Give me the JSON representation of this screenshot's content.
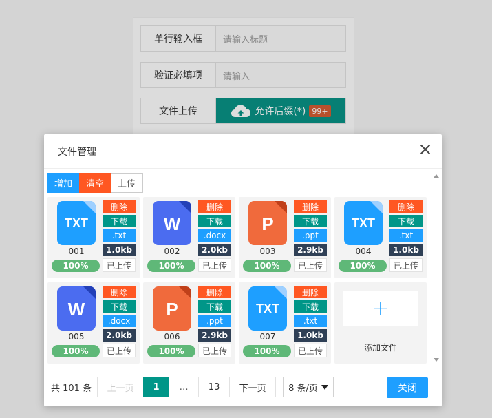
{
  "form": {
    "row1_label": "单行输入框",
    "row1_placeholder": "请输入标题",
    "row2_label": "验证必填项",
    "row2_placeholder": "请输入",
    "row3_label": "文件上传",
    "upload_label": "允许后缀(*)",
    "upload_badge": "99+"
  },
  "modal": {
    "title": "文件管理",
    "toolbar": {
      "add": "增加",
      "clear": "清空",
      "upload": "上传"
    },
    "files": [
      {
        "name": "001",
        "type": "txt",
        "glyph": "TXT",
        "ext": ".txt",
        "size": "1.0kb",
        "progress": "100%",
        "status": "已上传",
        "delete": "删除",
        "download": "下载",
        "color": "#1e9fff",
        "fold": "#9fd0ff"
      },
      {
        "name": "002",
        "type": "docx",
        "glyph": "W",
        "ext": ".docx",
        "size": "2.0kb",
        "progress": "100%",
        "status": "已上传",
        "delete": "删除",
        "download": "下载",
        "color": "#4b6cf0",
        "fold": "#2340b8"
      },
      {
        "name": "003",
        "type": "ppt",
        "glyph": "P",
        "ext": ".ppt",
        "size": "2.9kb",
        "progress": "100%",
        "status": "已上传",
        "delete": "删除",
        "download": "下载",
        "color": "#f06a3c",
        "fold": "#c0401a"
      },
      {
        "name": "004",
        "type": "txt",
        "glyph": "TXT",
        "ext": ".txt",
        "size": "1.0kb",
        "progress": "100%",
        "status": "已上传",
        "delete": "删除",
        "download": "下载",
        "color": "#1e9fff",
        "fold": "#9fd0ff"
      },
      {
        "name": "005",
        "type": "docx",
        "glyph": "W",
        "ext": ".docx",
        "size": "2.0kb",
        "progress": "100%",
        "status": "已上传",
        "delete": "删除",
        "download": "下载",
        "color": "#4b6cf0",
        "fold": "#2340b8"
      },
      {
        "name": "006",
        "type": "ppt",
        "glyph": "P",
        "ext": ".ppt",
        "size": "2.9kb",
        "progress": "100%",
        "status": "已上传",
        "delete": "删除",
        "download": "下载",
        "color": "#f06a3c",
        "fold": "#c0401a"
      },
      {
        "name": "007",
        "type": "txt",
        "glyph": "TXT",
        "ext": ".txt",
        "size": "1.0kb",
        "progress": "100%",
        "status": "已上传",
        "delete": "删除",
        "download": "下载",
        "color": "#1e9fff",
        "fold": "#9fd0ff"
      }
    ],
    "add_file_label": "添加文件",
    "add_plus": "+",
    "pager": {
      "total": "共 101 条",
      "prev": "上一页",
      "current": "1",
      "ellipsis": "…",
      "last": "13",
      "next": "下一页",
      "per_page": "8 条/页"
    },
    "close_label": "关闭"
  }
}
